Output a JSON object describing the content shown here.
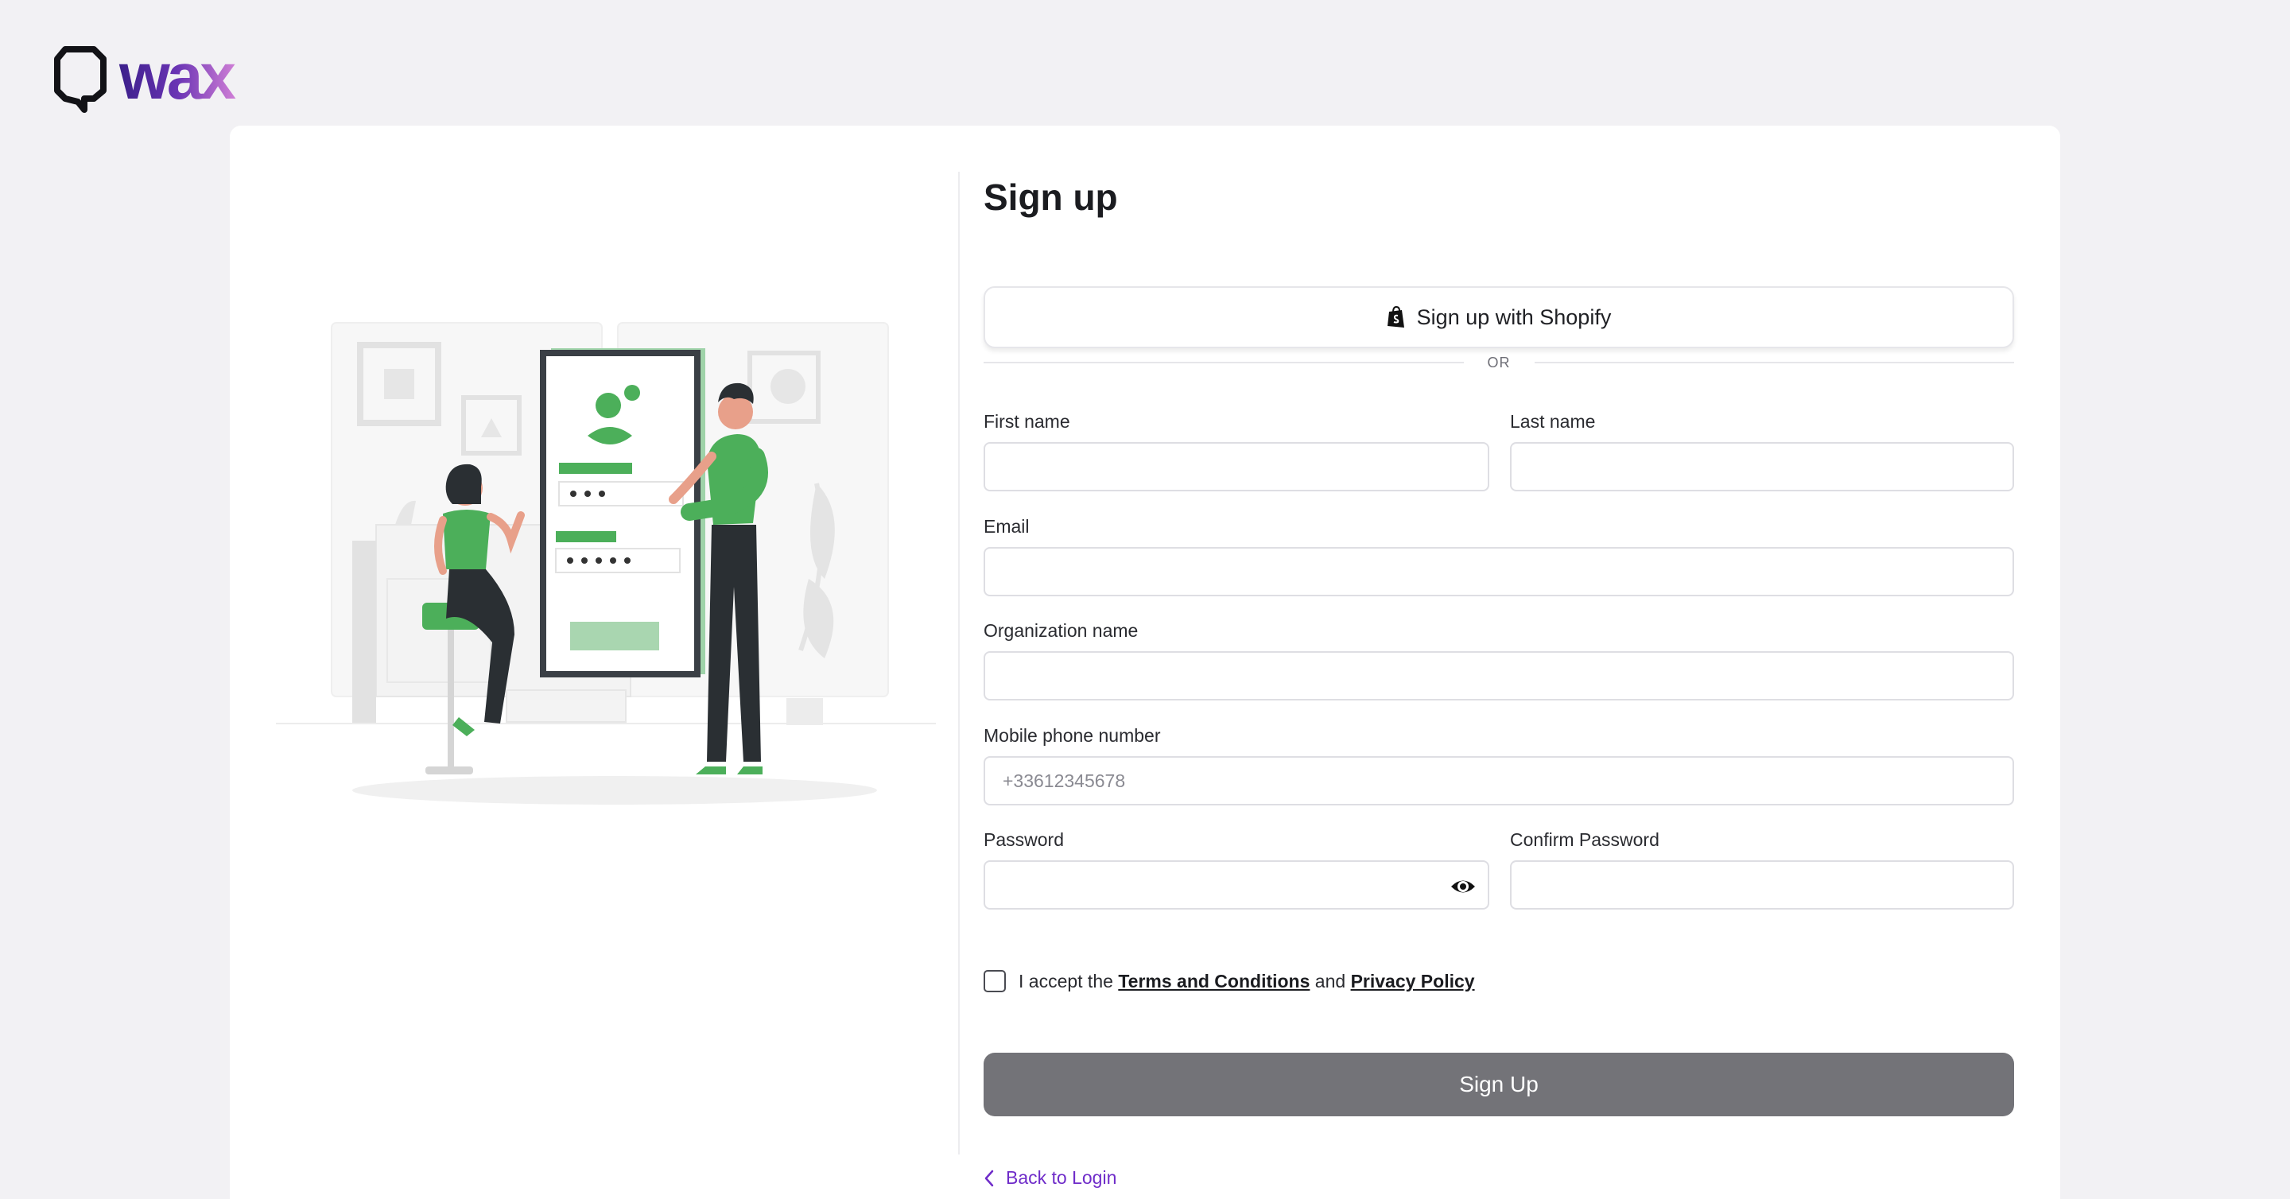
{
  "brand": {
    "logo_text": "wax",
    "colors": {
      "logo_dark": "#3b1f8a",
      "logo_light": "#c77bd8",
      "accent": "#6f2cc9"
    }
  },
  "signup": {
    "title": "Sign up",
    "shopify_label": "Sign up with Shopify",
    "shopify_icon": "shopping-bag-icon",
    "or_text": "OR",
    "fields": {
      "first_name": {
        "label": "First name",
        "value": "",
        "placeholder": ""
      },
      "last_name": {
        "label": "Last name",
        "value": "",
        "placeholder": ""
      },
      "email": {
        "label": "Email",
        "value": "",
        "placeholder": ""
      },
      "organization": {
        "label": "Organization name",
        "value": "",
        "placeholder": ""
      },
      "phone": {
        "label": "Mobile phone number",
        "value": "",
        "placeholder": "+33612345678"
      },
      "password": {
        "label": "Password",
        "value": "",
        "placeholder": ""
      },
      "confirm_password": {
        "label": "Confirm Password",
        "value": "",
        "placeholder": ""
      }
    },
    "terms": {
      "prefix": "I accept the",
      "terms_link": "Terms and Conditions",
      "middle": "and",
      "privacy_link": "Privacy Policy",
      "checked": false
    },
    "submit_label": "Sign Up",
    "back_label": "Back to Login"
  }
}
